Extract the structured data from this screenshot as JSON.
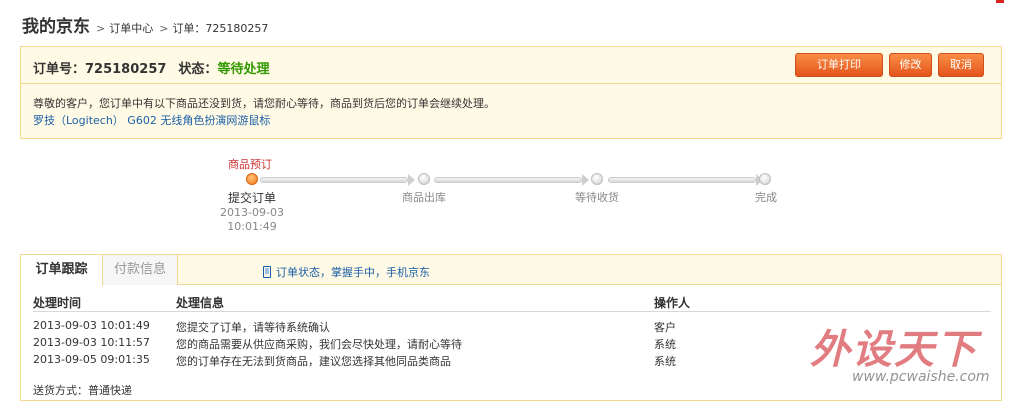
{
  "breadcrumb": {
    "home": "我的京东",
    "sep": ">",
    "center": "订单中心",
    "order": "订单：725180257"
  },
  "order": {
    "number_label": "订单号：725180257",
    "status_label": "状态：",
    "status_value": "等待处理",
    "buttons": {
      "print": "订单打印",
      "edit": "修改",
      "cancel": "取消"
    },
    "message": "尊敬的客户，您订单中有以下商品还没到货，请您耐心等待，商品到货后您的订单会继续处理。",
    "product": "罗技（Logitech） G602 无线角色扮演网游鼠标"
  },
  "progress": {
    "pre_label": "商品预订",
    "steps": [
      {
        "label": "提交订单",
        "date": "2013-09-03",
        "time": "10:01:49",
        "active": true
      },
      {
        "label": "商品出库",
        "active": false
      },
      {
        "label": "等待收货",
        "active": false
      },
      {
        "label": "完成",
        "active": false
      }
    ]
  },
  "tracking": {
    "tabs": [
      "订单跟踪",
      "付款信息"
    ],
    "mobile_promo": "订单状态，掌握手中，手机京东",
    "columns": [
      "处理时间",
      "处理信息",
      "操作人"
    ],
    "rows": [
      {
        "time": "2013-09-03 10:01:49",
        "info": "您提交了订单，请等待系统确认",
        "operator": "客户"
      },
      {
        "time": "2013-09-03 10:11:57",
        "info": "您的商品需要从供应商采购，我们会尽快处理，请耐心等待",
        "operator": "系统"
      },
      {
        "time": "2013-09-05 09:01:35",
        "info": "您的订单存在无法到货商品，建议您选择其他同品类商品",
        "operator": "系统"
      }
    ],
    "shipping": "送货方式：普通快递"
  },
  "watermark": {
    "brand": "外设天下",
    "url": "www.pcwaishe.com"
  },
  "colors": {
    "accent": "#e4541b",
    "status_green": "#339900",
    "link_blue": "#1a5fa8",
    "panel_bg": "#fffae5",
    "panel_border": "#f1d98f"
  }
}
